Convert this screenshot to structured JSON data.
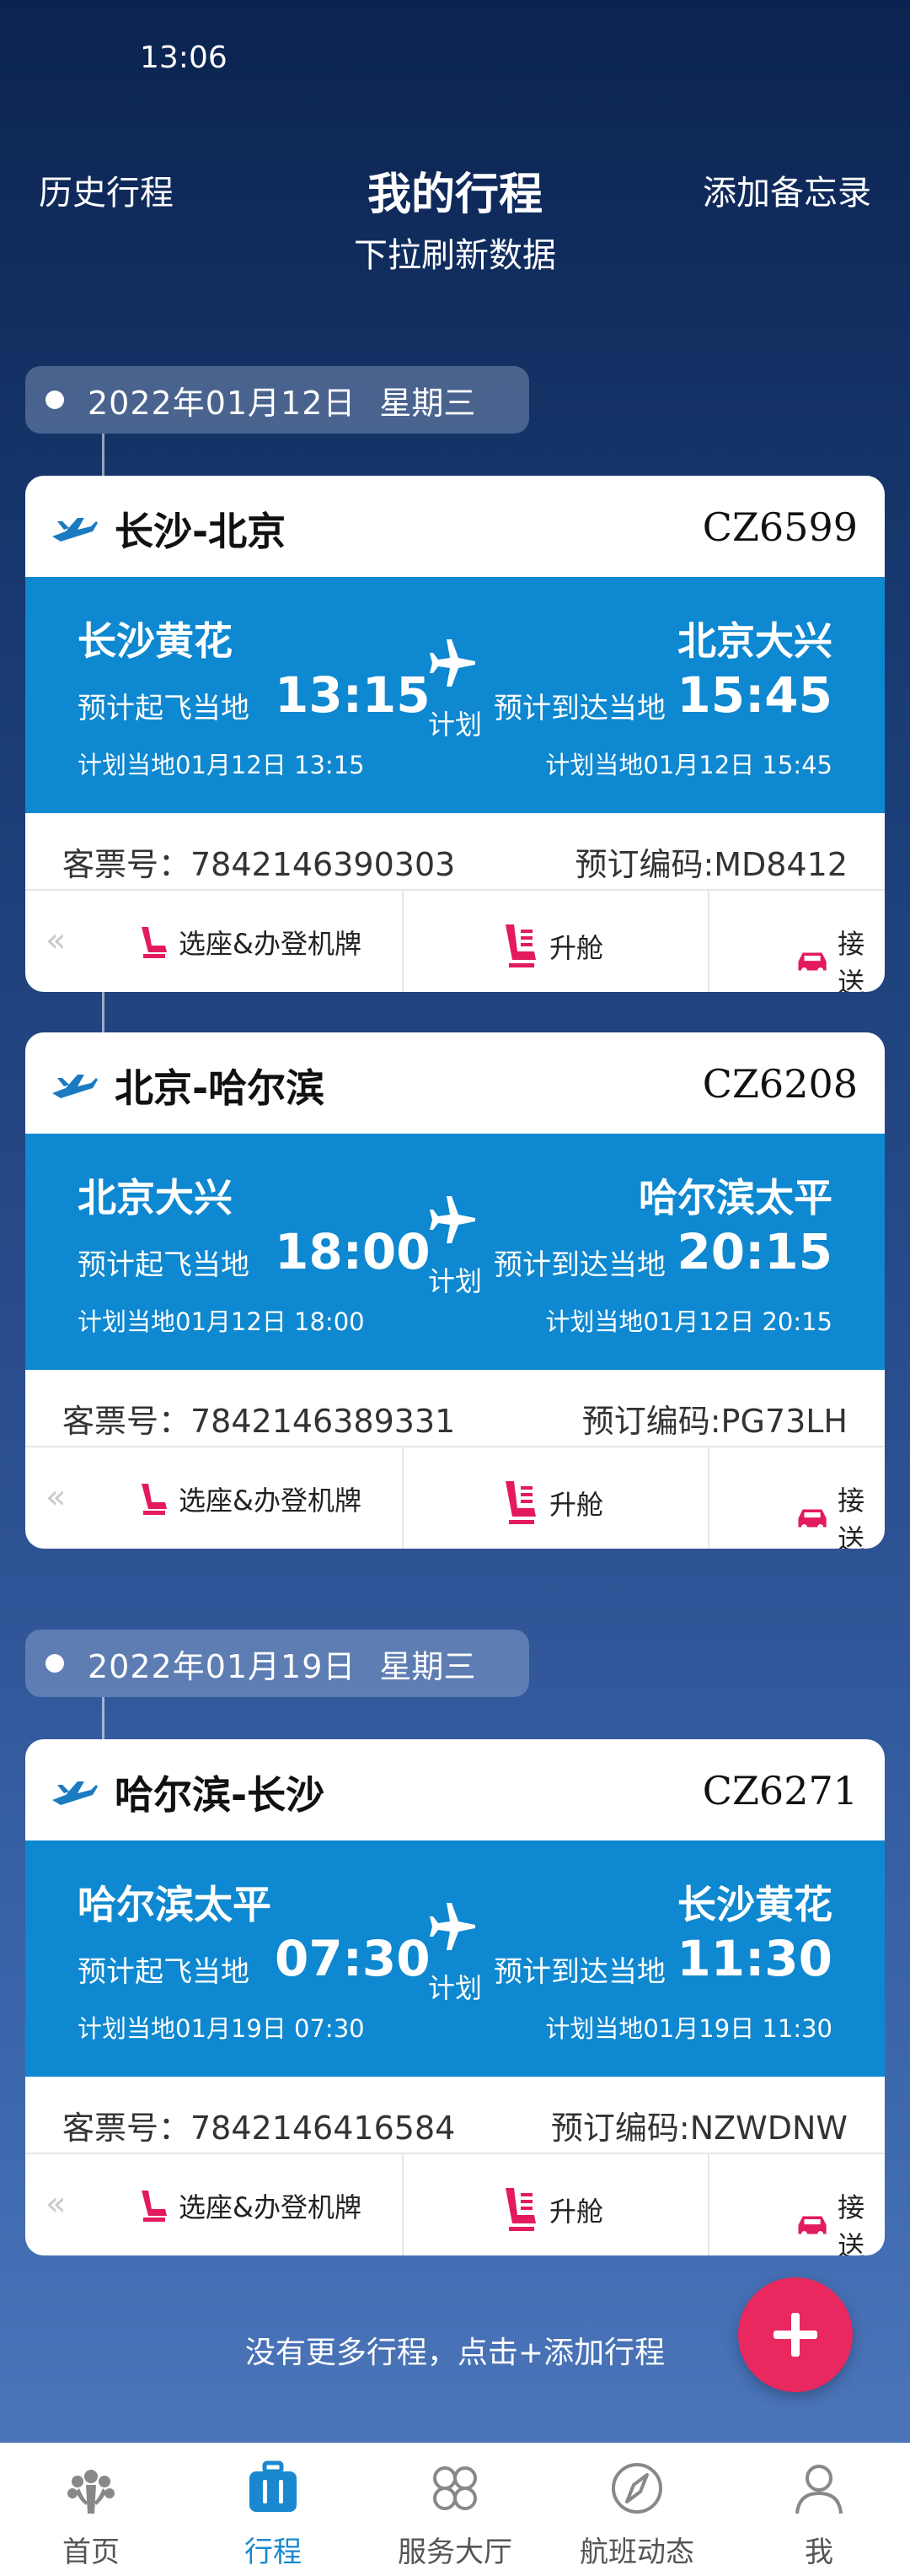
{
  "status_bar": {
    "time": "13:06"
  },
  "header": {
    "left": "历史行程",
    "title": "我的行程",
    "subtitle": "下拉刷新数据",
    "right": "添加备忘录"
  },
  "groups": [
    {
      "date": "2022年01月12日",
      "weekday": "星期三"
    },
    {
      "date": "2022年01月19日",
      "weekday": "星期三"
    }
  ],
  "trips": [
    {
      "route": "长沙-北京",
      "flight_no": "CZ6599",
      "dep_city": "长沙黄花",
      "arr_city": "北京大兴",
      "dep_label": "预计起飞当地",
      "dep_time": "13:15",
      "arr_label": "预计到达当地",
      "arr_time": "15:45",
      "status": "计划",
      "dep_plan": "计划当地01月12日 13:15",
      "arr_plan": "计划当地01月12日 15:45",
      "ticket": "客票号：7842146390303",
      "booking": "预订编码:MD8412"
    },
    {
      "route": "北京-哈尔滨",
      "flight_no": "CZ6208",
      "dep_city": "北京大兴",
      "arr_city": "哈尔滨太平",
      "dep_label": "预计起飞当地",
      "dep_time": "18:00",
      "arr_label": "预计到达当地",
      "arr_time": "20:15",
      "status": "计划",
      "dep_plan": "计划当地01月12日 18:00",
      "arr_plan": "计划当地01月12日 20:15",
      "ticket": "客票号：7842146389331",
      "booking": "预订编码:PG73LH"
    },
    {
      "route": "哈尔滨-长沙",
      "flight_no": "CZ6271",
      "dep_city": "哈尔滨太平",
      "arr_city": "长沙黄花",
      "dep_label": "预计起飞当地",
      "dep_time": "07:30",
      "arr_label": "预计到达当地",
      "arr_time": "11:30",
      "status": "计划",
      "dep_plan": "计划当地01月19日 07:30",
      "arr_plan": "计划当地01月19日 11:30",
      "ticket": "客票号：7842146416584",
      "booking": "预订编码:NZWDNW"
    }
  ],
  "actions": {
    "prev": "«",
    "checkin": "选座&办登机牌",
    "upgrade": "升舱",
    "transfer": "接送"
  },
  "footer": {
    "no_more": "没有更多行程，点击+添加行程"
  },
  "tabs": [
    {
      "label": "首页"
    },
    {
      "label": "行程"
    },
    {
      "label": "服务大厅"
    },
    {
      "label": "航班动态"
    },
    {
      "label": "我"
    }
  ],
  "colors": {
    "accent_blue": "#0e88d0",
    "fab_pink": "#e8285e",
    "action_pink": "#e31b5d"
  }
}
